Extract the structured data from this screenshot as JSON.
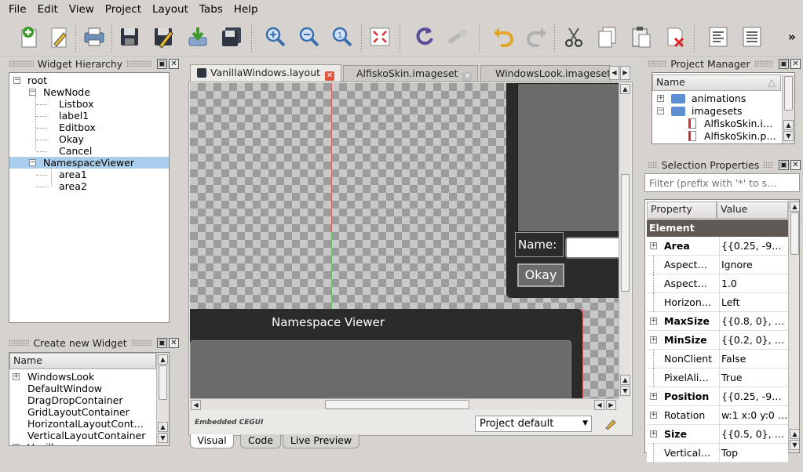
{
  "menu": [
    "File",
    "Edit",
    "View",
    "Project",
    "Layout",
    "Tabs",
    "Help"
  ],
  "toolbar": {
    "icons": [
      "new-file-icon",
      "edit-pencil-icon",
      "print-icon",
      "save-icon",
      "save-edit-icon",
      "download-icon",
      "save-all-icon",
      "zoom-in-icon",
      "zoom-out-icon",
      "zoom-reset-icon",
      "fit-screen-icon",
      "reload-icon",
      "wrench-icon",
      "undo-icon",
      "redo-icon",
      "cut-icon",
      "copy-icon",
      "paste-icon",
      "delete-icon",
      "align-left-icon",
      "align-justify-icon"
    ],
    "overflow": "»"
  },
  "widget_hierarchy": {
    "title": "Widget Hierarchy",
    "nodes": [
      {
        "label": "root",
        "level": 0,
        "expander": "−"
      },
      {
        "label": "NewNode",
        "level": 1,
        "expander": "−"
      },
      {
        "label": "Listbox",
        "level": 2
      },
      {
        "label": "label1",
        "level": 2
      },
      {
        "label": "Editbox",
        "level": 2
      },
      {
        "label": "Okay",
        "level": 2
      },
      {
        "label": "Cancel",
        "level": 2
      },
      {
        "label": "NamespaceViewer",
        "level": 1,
        "expander": "−",
        "selected": true
      },
      {
        "label": "area1",
        "level": 2
      },
      {
        "label": "area2",
        "level": 2
      }
    ]
  },
  "create_widget": {
    "title": "Create new Widget",
    "header": "Name",
    "items": [
      "WindowsLook",
      "DefaultWindow",
      "DragDropContainer",
      "GridLayoutContainer",
      "HorizontalLayoutCont…",
      "VerticalLayoutContainer",
      "Vanilla"
    ]
  },
  "tabs": [
    {
      "label": "VanillaWindows.layout",
      "active": true
    },
    {
      "label": "AlfiskoSkin.imageset"
    },
    {
      "label": "WindowsLook.imageset"
    }
  ],
  "canvas": {
    "name_label": "Name:",
    "okay_button": "Okay",
    "namespace_title": "Namespace Viewer"
  },
  "editor_footer": {
    "embedded_label": "Embedded CEGUI",
    "project_select": "Project default",
    "view_tabs": [
      "Visual",
      "Code",
      "Live Preview"
    ]
  },
  "project_manager": {
    "title": "Project Manager",
    "header": "Name",
    "items": [
      {
        "label": "animations",
        "type": "folder",
        "expander": "+"
      },
      {
        "label": "imagesets",
        "type": "folder",
        "expander": "−"
      },
      {
        "label": "AlfiskoSkin.i…",
        "type": "file"
      },
      {
        "label": "AlfiskoSkin.p…",
        "type": "file"
      }
    ]
  },
  "selection_properties": {
    "title": "Selection Properties",
    "filter_placeholder": "Filter (prefix with '*' to s…",
    "col_property": "Property",
    "col_value": "Value",
    "category": "Element",
    "rows": [
      {
        "name": "Area",
        "value": "{{0.25, -9…",
        "bold": true,
        "expander": true
      },
      {
        "name": "Aspect…",
        "value": "Ignore"
      },
      {
        "name": "Aspect…",
        "value": "1.0"
      },
      {
        "name": "Horizon…",
        "value": "Left"
      },
      {
        "name": "MaxSize",
        "value": "{{0.8, 0}, …",
        "bold": true,
        "expander": true
      },
      {
        "name": "MinSize",
        "value": "{{0.2, 0}, …",
        "bold": true,
        "expander": true
      },
      {
        "name": "NonClient",
        "value": "False"
      },
      {
        "name": "PixelAli…",
        "value": "True"
      },
      {
        "name": "Position",
        "value": "{{0.25, -9…",
        "bold": true,
        "expander": true
      },
      {
        "name": "Rotation",
        "value": "w:1 x:0 y:0 …",
        "expander": true
      },
      {
        "name": "Size",
        "value": "{{0.5, 0}, …",
        "bold": true,
        "expander": true
      },
      {
        "name": "Vertical…",
        "value": "Top"
      }
    ]
  },
  "colors": {
    "selection": "#a9cdea",
    "window_dark": "#2b2b2b",
    "accent_red": "#e0533d"
  }
}
